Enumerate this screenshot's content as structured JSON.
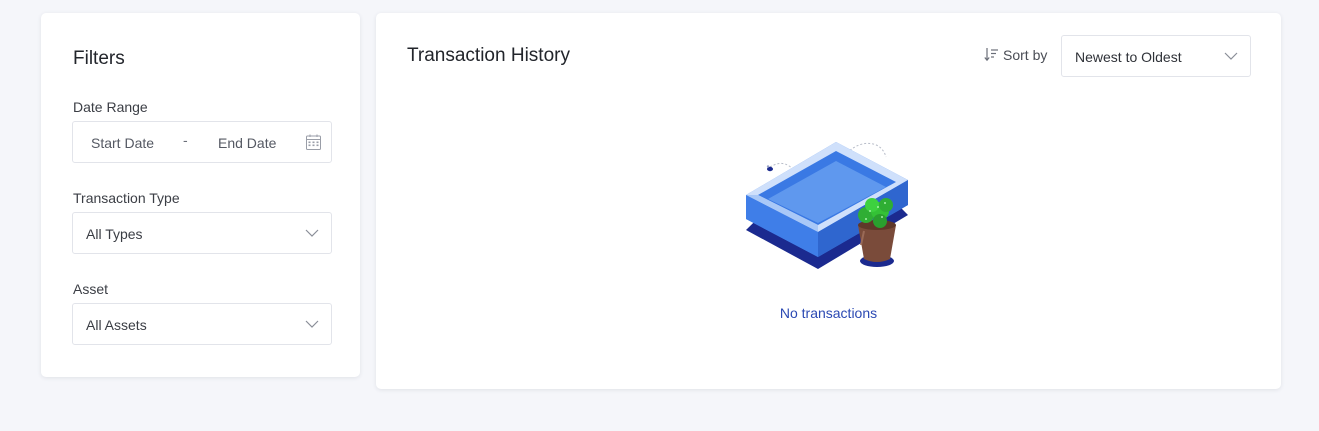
{
  "filters": {
    "title": "Filters",
    "date_range": {
      "label": "Date Range",
      "start_placeholder": "Start Date",
      "separator": "-",
      "end_placeholder": "End Date"
    },
    "transaction_type": {
      "label": "Transaction Type",
      "value": "All Types"
    },
    "asset": {
      "label": "Asset",
      "value": "All Assets"
    }
  },
  "history": {
    "title": "Transaction History",
    "sort_label": "Sort by",
    "sort_value": "Newest to Oldest",
    "empty_message": "No transactions"
  },
  "colors": {
    "accent": "#2b49b3",
    "tray_blue": "#3f7ee8",
    "tray_dark": "#1b2a8f",
    "plant_green": "#34c236",
    "pot_brown": "#7a4b3a"
  },
  "icons": [
    "calendar-icon",
    "chevron-down-icon",
    "sort-icon",
    "empty-tray-illustration"
  ]
}
